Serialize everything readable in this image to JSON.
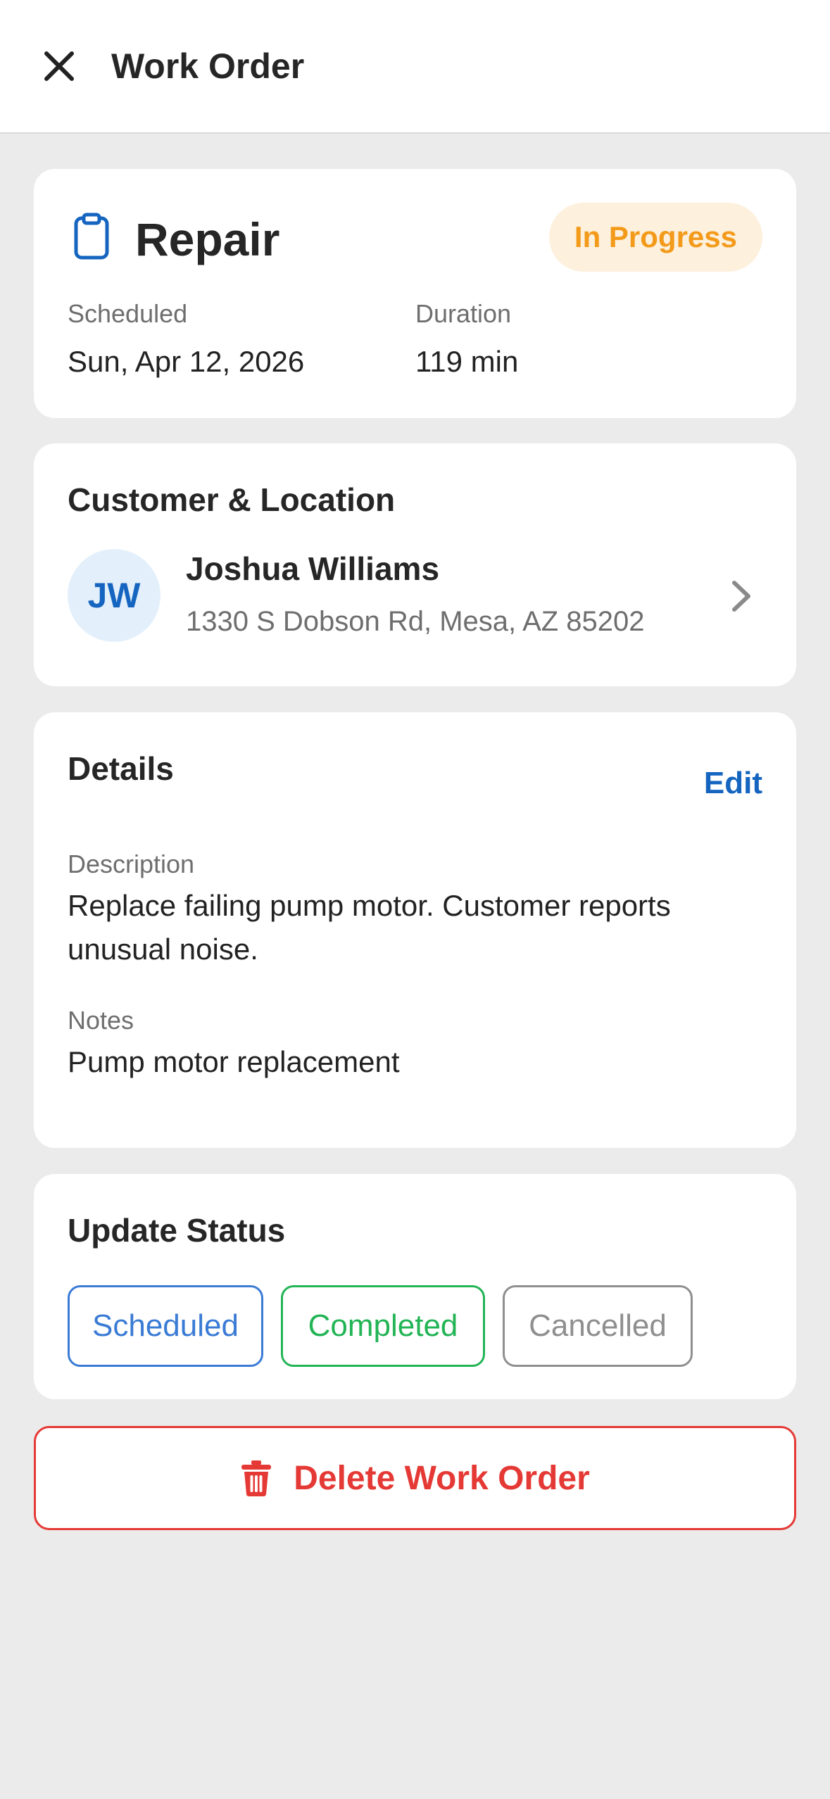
{
  "header": {
    "title": "Work Order",
    "close_icon": "close-icon"
  },
  "summary": {
    "type": "Repair",
    "type_icon": "clipboard-icon",
    "status": "In Progress",
    "scheduled_label": "Scheduled",
    "scheduled_value": "Sun, Apr 12, 2026",
    "duration_label": "Duration",
    "duration_value": "119 min"
  },
  "customer": {
    "section_title": "Customer & Location",
    "initials": "JW",
    "name": "Joshua Williams",
    "address": "1330 S Dobson Rd, Mesa, AZ 85202"
  },
  "details": {
    "section_title": "Details",
    "edit_label": "Edit",
    "description_label": "Description",
    "description_value": "Replace failing pump motor. Customer reports unusual noise.",
    "notes_label": "Notes",
    "notes_value": "Pump motor replacement"
  },
  "update_status": {
    "section_title": "Update Status",
    "options": [
      "Scheduled",
      "Completed",
      "Cancelled"
    ]
  },
  "delete": {
    "label": "Delete Work Order",
    "icon": "trash-icon"
  },
  "colors": {
    "accent": "#1565c0",
    "status_in_progress": "#f39a1a",
    "status_scheduled": "#3a7bd5",
    "status_completed": "#22b455",
    "status_cancelled": "#8f8f8f",
    "danger": "#e53935"
  }
}
